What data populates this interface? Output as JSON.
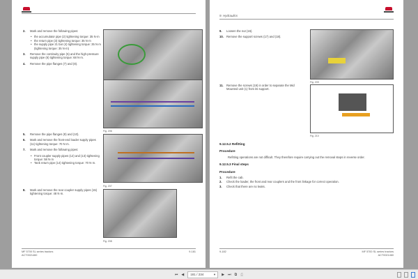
{
  "left_page": {
    "steps_a": [
      {
        "n": "2.",
        "text": "Mark and remove the following pipes:",
        "bullets": [
          "the accumulator pipe (2) tightening torque: 35 N·m",
          "the return pipe (3) tightening torque: 35 N·m",
          "the supply pipe 21 bar (4) tightening torque: 35 N·m (tightening torque: 35 N·m)"
        ]
      },
      {
        "n": "3.",
        "text": "Remove the continuity pipe (5) and the high-pressure supply pipe (6) tightening torque: 68 N·m."
      },
      {
        "n": "4.",
        "text": "Remove the pipe flanges (7) and (8)."
      }
    ],
    "steps_b": [
      {
        "n": "5.",
        "text": "Remove the pipe flanges (9) and (10)."
      },
      {
        "n": "6.",
        "text": "Mark and remove the front-end loader supply pipes (11) tightening torque: 70 N·m."
      },
      {
        "n": "7.",
        "text": "Mark and remove the following pipes:",
        "bullets": [
          "Front coupler supply pipes (12) and (13) tightening torque: 58 N·m",
          "Tank return pipe (14) tightening torque: 70 N·m."
        ]
      }
    ],
    "step_8": {
      "n": "8.",
      "text": "Mark and remove the rear coupler supply pipes (15) tightening torque: 48 N·m."
    },
    "captions": [
      "Fig. 206",
      "Fig. 207",
      "Fig. 208"
    ],
    "footer": {
      "title": "MF 5700 SL series tractors",
      "code": "ACT0021460",
      "page": "9-181"
    }
  },
  "right_page": {
    "header": "9. Hydraulics",
    "steps_a": [
      {
        "n": "9.",
        "text": "Loosen the nut (16)."
      },
      {
        "n": "10.",
        "text": "Remove the support screws (17) and (18)."
      }
    ],
    "step_11": {
      "n": "11.",
      "text": "Remove the screws (19) in order to separate the Mid Mounted unit (1) from its support."
    },
    "captions": [
      "Fig. 209",
      "Fig. 210"
    ],
    "refitting": {
      "heading": "9.12.5.2 Refitting",
      "proc": "Procedure",
      "text": "Refitting operations are not difficult. They therefore require carrying out the removal steps in reverse order."
    },
    "final": {
      "heading": "9.12.5.3 Final steps",
      "proc": "Procedure",
      "steps": [
        {
          "n": "1.",
          "text": "Refit the cab."
        },
        {
          "n": "2.",
          "text": "Check the loader, the front and rear couplers and the front linkage for correct operation."
        },
        {
          "n": "3.",
          "text": "Check that there are no leaks."
        }
      ]
    },
    "footer": {
      "title": "MF 5700 SL series tractors",
      "code": "ACT0021460",
      "page": "9-182"
    }
  },
  "toolbar": {
    "page_value": "181 / 234"
  }
}
